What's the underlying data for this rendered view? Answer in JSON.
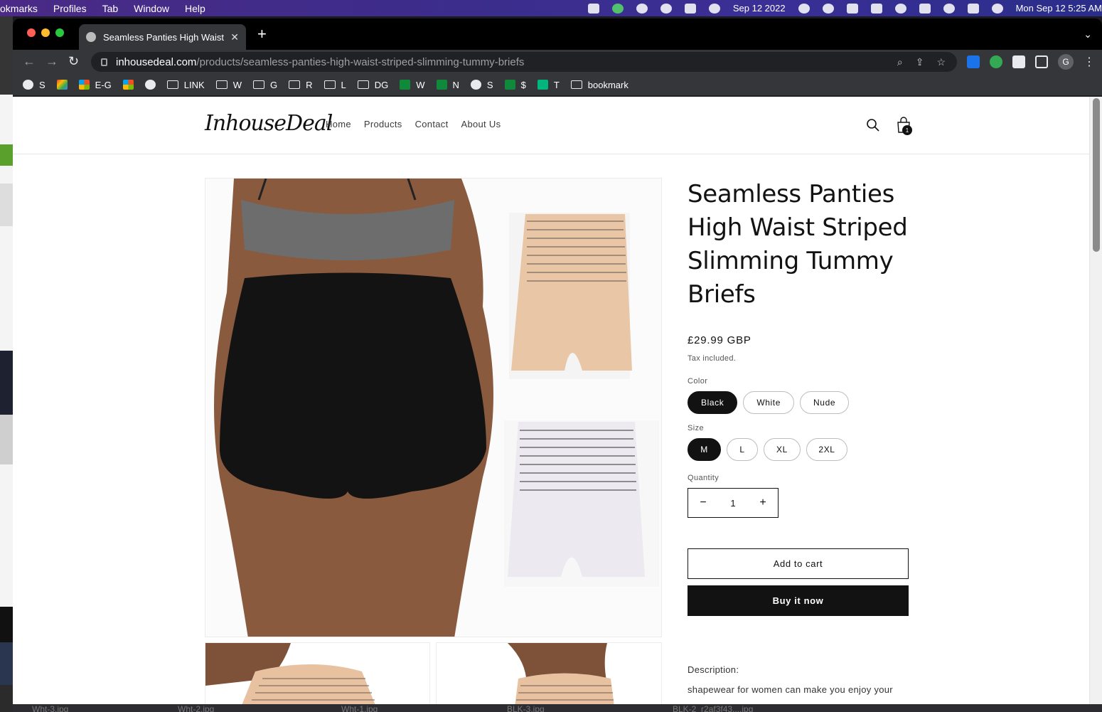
{
  "menubar": {
    "items": [
      "okmarks",
      "Profiles",
      "Tab",
      "Window",
      "Help"
    ],
    "date": "Sep 12 2022",
    "clock": "Mon Sep 12  5:25 AM"
  },
  "browser": {
    "tab_title": "Seamless Panties High Waist S",
    "url_host": "inhousedeal.com",
    "url_path": "/products/seamless-panties-high-waist-striped-slimming-tummy-briefs",
    "profile_initial": "G",
    "bookmarks": [
      {
        "icon": "globe",
        "label": "S"
      },
      {
        "icon": "gmail",
        "label": ""
      },
      {
        "icon": "ms",
        "label": "E-G"
      },
      {
        "icon": "ms",
        "label": ""
      },
      {
        "icon": "globe",
        "label": ""
      },
      {
        "icon": "folder",
        "label": "LINK"
      },
      {
        "icon": "folder",
        "label": "W"
      },
      {
        "icon": "folder",
        "label": "G"
      },
      {
        "icon": "folder",
        "label": "R"
      },
      {
        "icon": "folder",
        "label": "L"
      },
      {
        "icon": "folder",
        "label": "DG"
      },
      {
        "icon": "plus",
        "label": "W"
      },
      {
        "icon": "plus",
        "label": "N"
      },
      {
        "icon": "globe",
        "label": "S"
      },
      {
        "icon": "plus",
        "label": "$"
      },
      {
        "icon": "star",
        "label": "T"
      },
      {
        "icon": "folder",
        "label": "bookmark"
      }
    ]
  },
  "site": {
    "logo": "InhouseDeal",
    "nav": [
      "Home",
      "Products",
      "Contact",
      "About Us"
    ],
    "cart_count": "1"
  },
  "product": {
    "title": "Seamless Panties High Waist Striped Slimming Tummy Briefs",
    "price": "£29.99 GBP",
    "tax_note": "Tax included.",
    "color_label": "Color",
    "colors": [
      "Black",
      "White",
      "Nude"
    ],
    "selected_color": "Black",
    "size_label": "Size",
    "sizes": [
      "M",
      "L",
      "XL",
      "2XL"
    ],
    "selected_size": "M",
    "quantity_label": "Quantity",
    "quantity": "1",
    "add_to_cart": "Add to cart",
    "buy_now": "Buy it now",
    "description_label": "Description:",
    "description": "shapewear for women can make you enjoy your beautiful curve at anytime. With high waist"
  },
  "taskbar": [
    "Wht-3.jpg",
    "Wht-2.jpg",
    "Wht-1.jpg",
    "BLK-3.jpg",
    "BLK-2_r2af3f43....jpg"
  ]
}
